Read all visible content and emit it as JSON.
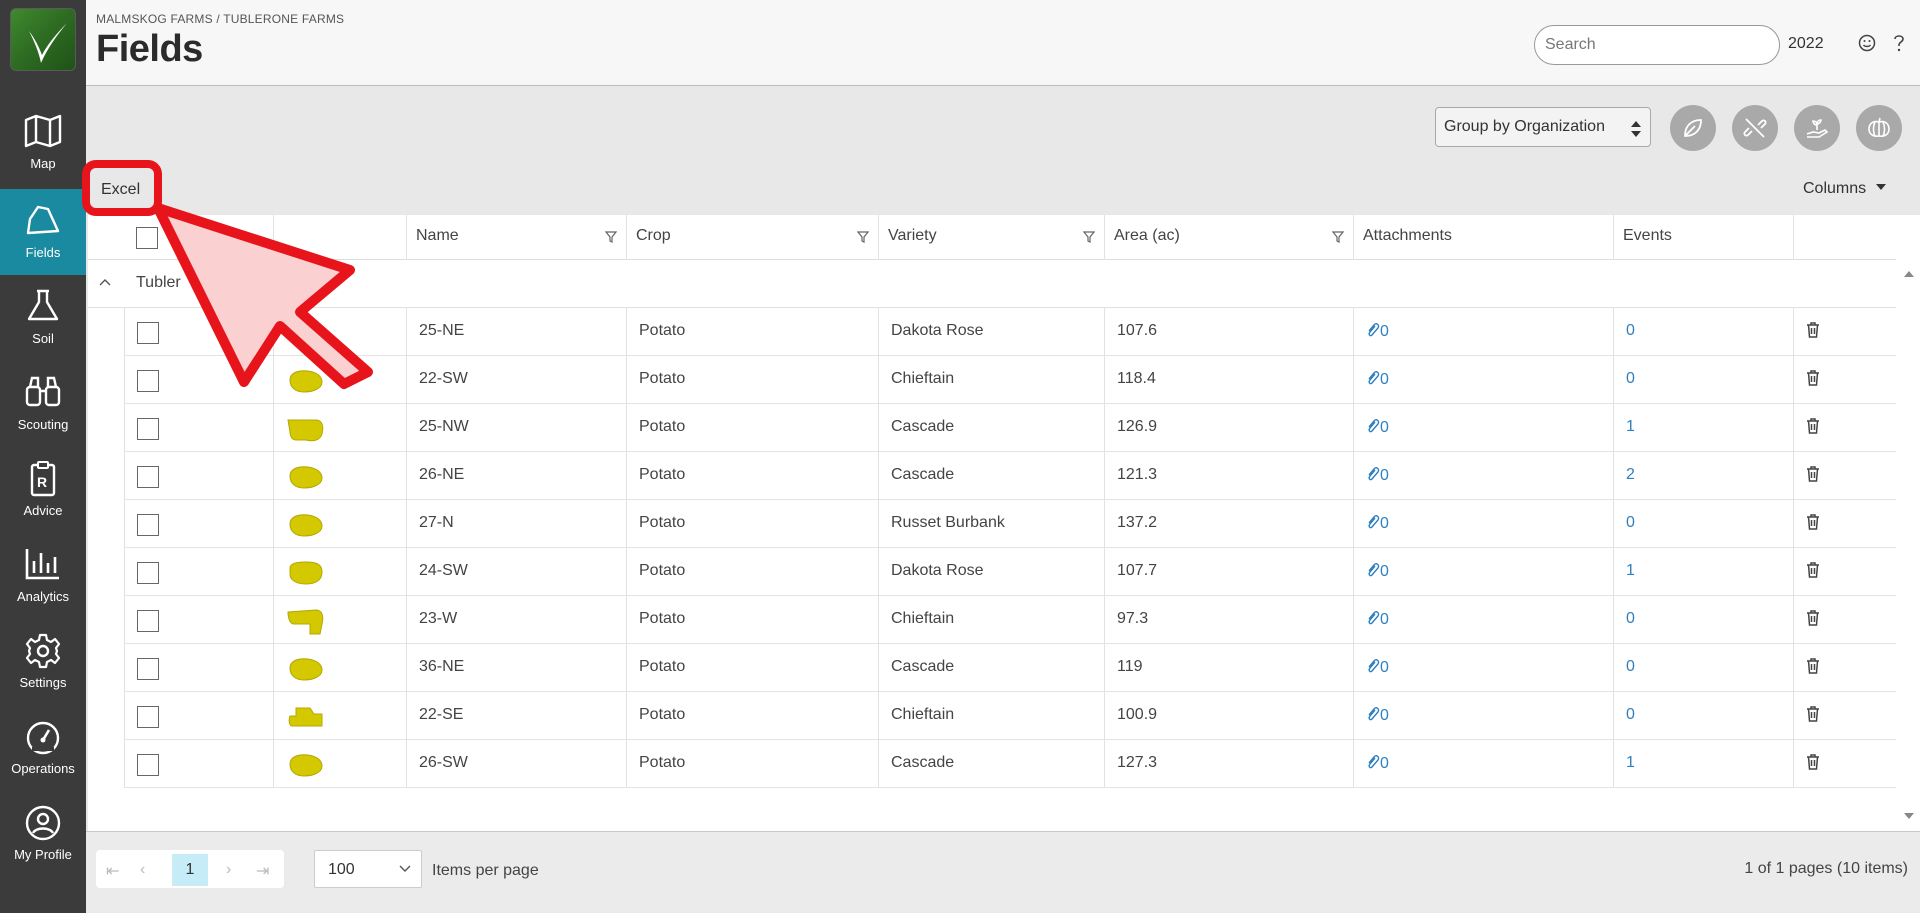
{
  "sidebar": {
    "items": [
      {
        "label": "Map",
        "icon": "map-icon"
      },
      {
        "label": "Fields",
        "icon": "field-icon",
        "active": true
      },
      {
        "label": "Soil",
        "icon": "flask-icon"
      },
      {
        "label": "Scouting",
        "icon": "binoculars-icon"
      },
      {
        "label": "Advice",
        "icon": "prescription-icon"
      },
      {
        "label": "Analytics",
        "icon": "bar-chart-icon"
      },
      {
        "label": "Settings",
        "icon": "gear-icon"
      },
      {
        "label": "Operations",
        "icon": "gauge-icon"
      },
      {
        "label": "My Profile",
        "icon": "user-icon"
      }
    ]
  },
  "header": {
    "breadcrumb": "MALMSKOG FARMS / TUBLERONE FARMS",
    "title": "Fields",
    "search_placeholder": "Search",
    "year": "2022"
  },
  "toolbar": {
    "group_by": "Group by Organization",
    "excel_label": "Excel",
    "columns_label": "Columns"
  },
  "table": {
    "columns": [
      "Name",
      "Crop",
      "Variety",
      "Area (ac)",
      "Attachments",
      "Events"
    ],
    "group_name": "Tubler",
    "rows": [
      {
        "name": "25-NE",
        "crop": "Potato",
        "variety": "Dakota Rose",
        "area": "107.6",
        "attachments": "0",
        "events": "0"
      },
      {
        "name": "22-SW",
        "crop": "Potato",
        "variety": "Chieftain",
        "area": "118.4",
        "attachments": "0",
        "events": "0"
      },
      {
        "name": "25-NW",
        "crop": "Potato",
        "variety": "Cascade",
        "area": "126.9",
        "attachments": "0",
        "events": "1"
      },
      {
        "name": "26-NE",
        "crop": "Potato",
        "variety": "Cascade",
        "area": "121.3",
        "attachments": "0",
        "events": "2"
      },
      {
        "name": "27-N",
        "crop": "Potato",
        "variety": "Russet Burbank",
        "area": "137.2",
        "attachments": "0",
        "events": "0"
      },
      {
        "name": "24-SW",
        "crop": "Potato",
        "variety": "Dakota Rose",
        "area": "107.7",
        "attachments": "0",
        "events": "1"
      },
      {
        "name": "23-W",
        "crop": "Potato",
        "variety": "Chieftain",
        "area": "97.3",
        "attachments": "0",
        "events": "0"
      },
      {
        "name": "36-NE",
        "crop": "Potato",
        "variety": "Cascade",
        "area": "119",
        "attachments": "0",
        "events": "0"
      },
      {
        "name": "22-SE",
        "crop": "Potato",
        "variety": "Chieftain",
        "area": "100.9",
        "attachments": "0",
        "events": "0"
      },
      {
        "name": "26-SW",
        "crop": "Potato",
        "variety": "Cascade",
        "area": "127.3",
        "attachments": "0",
        "events": "1"
      }
    ]
  },
  "footer": {
    "current_page": "1",
    "per_page": "100",
    "per_page_label": "Items per page",
    "page_info": "1 of 1 pages (10 items)"
  },
  "colors": {
    "sidebar_bg": "#3b3b3b",
    "active_nav": "#1a8aa0",
    "field_shape": "#d4c800",
    "link": "#2f7fc1",
    "annotation_red": "#e8141c"
  }
}
